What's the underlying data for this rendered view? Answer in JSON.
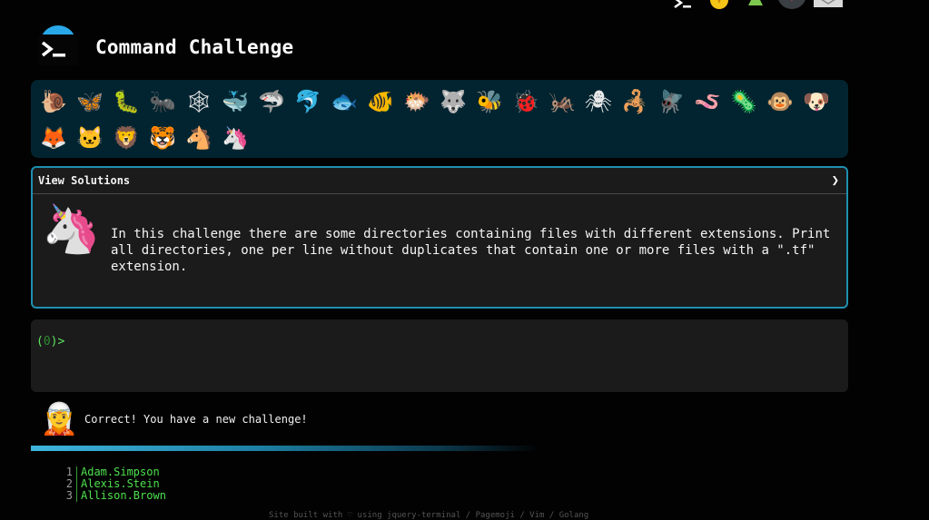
{
  "header": {
    "title": "Command Challenge",
    "top_icons": [
      "terminal-icon",
      "fire-icon",
      "tree-icon",
      "badge-icon",
      "mail-icon"
    ]
  },
  "animals": {
    "row1": [
      "🐌",
      "🦋",
      "🐛",
      "🐜",
      "🕸",
      "🐳",
      "🦈",
      "🐬",
      "🐟",
      "🐠",
      "🐡",
      "🐺",
      "🐝",
      "🐞",
      "🦗",
      "🕷",
      "🦂",
      "🪰",
      "🪱",
      "🦠",
      "🐵",
      "🐶"
    ],
    "row2": [
      "🦊",
      "🐱",
      "🦁",
      "🐯",
      "🐴",
      "🦄"
    ]
  },
  "solutions": {
    "label": "View Solutions",
    "chevron": "❯",
    "avatar": "🦄",
    "challenge": "In this challenge there are some directories containing files with different extensions. Print all directories, one per line without duplicates that contain one or more files with a \".tf\" extension."
  },
  "terminal": {
    "prompt_open": "(",
    "prompt_code": "0",
    "prompt_close": ")>"
  },
  "feedback": {
    "avatar": "🧝",
    "message": "Correct! You have a new challenge!"
  },
  "progress": {
    "value": 1.0
  },
  "answer": [
    {
      "num": "1",
      "text": "Adam.Simpson"
    },
    {
      "num": "2",
      "text": "Alexis.Stein"
    },
    {
      "num": "3",
      "text": "Allison.Brown"
    }
  ],
  "footer": "Site built with ♡ using jquery-terminal / Pagemoji / Vim / Golang",
  "colors": {
    "accent": "#1f8fb0",
    "prompt": "#5ee35e",
    "panel": "#022430"
  }
}
